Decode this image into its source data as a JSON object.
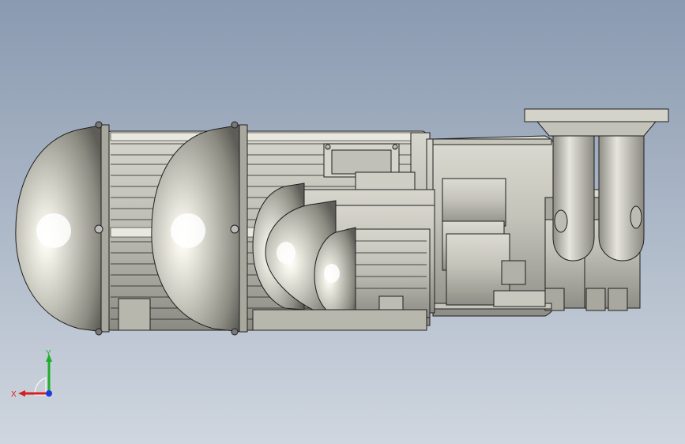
{
  "viewport": {
    "background_top": "#8a9ab0",
    "background_bottom": "#cfd6df",
    "model_color": "#c9c8bf",
    "edge_color": "#1f1f1f"
  },
  "triad": {
    "x_label": "X",
    "y_label": "Y",
    "x_color": "#d81e1e",
    "y_color": "#1fae2a",
    "z_color": "#1e3ad8"
  }
}
